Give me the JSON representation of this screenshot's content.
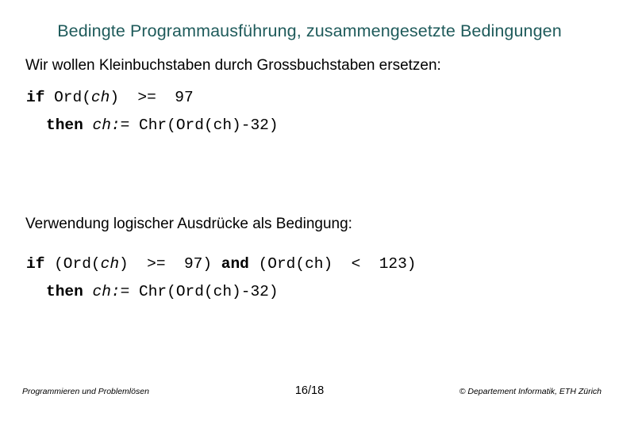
{
  "slide": {
    "title": "Bedingte Programmausführung, zusammengesetzte Bedingungen",
    "title_color": "#1f5b5b",
    "body_color": "#000000",
    "background_color": "#ffffff"
  },
  "content": {
    "paragraph_1": "Wir wollen Kleinbuchstaben durch Grossbuchstaben ersetzen:",
    "paragraph_2": "Verwendung logischer Ausdrücke als Bedingung:",
    "code_block_1": {
      "line_1": {
        "keyword": "if",
        "after_keyword": " Ord(",
        "variable": "ch",
        "tail": ")  >=  97"
      },
      "line_2": {
        "keyword": "then",
        "variable": " ch:=",
        "tail": " Chr(Ord(ch)-32)"
      }
    },
    "code_block_2": {
      "line_1": {
        "keyword": "if",
        "after_keyword": " (Ord(",
        "variable": "ch",
        "middle": ")  >=  97) ",
        "keyword_2": "and",
        "tail": " (Ord(ch)  <  123)"
      },
      "line_2": {
        "keyword": "then",
        "variable": " ch:=",
        "tail": " Chr(Ord(ch)-32)"
      }
    }
  },
  "footer": {
    "course": "Programmieren und Problemlösen",
    "page": "16/18",
    "copyright": "© Departement Informatik, ETH Zürich"
  }
}
